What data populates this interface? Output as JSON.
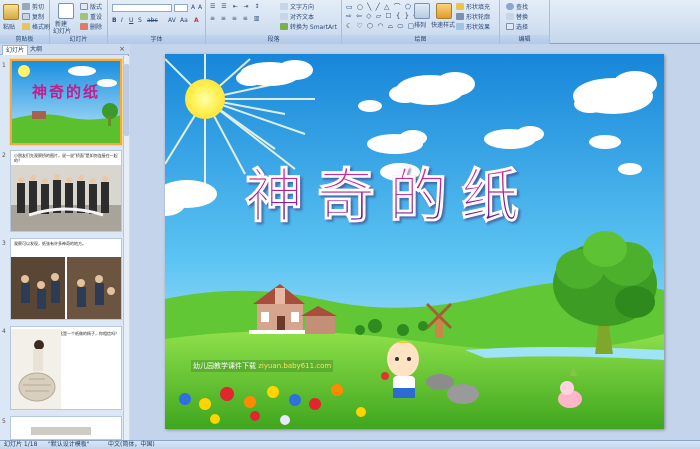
{
  "ribbon": {
    "clipboard": {
      "label": "剪贴板",
      "paste": "粘贴",
      "cut": "剪切",
      "copy": "复制",
      "format_painter": "格式刷"
    },
    "slides": {
      "label": "幻灯片",
      "new_slide": "新建",
      "new_slide_2": "幻灯片",
      "layout": "版式",
      "reset": "重设",
      "delete": "删除"
    },
    "font": {
      "label": "字体"
    },
    "paragraph": {
      "label": "段落",
      "text_direction": "文字方向",
      "align_text": "对齐文本",
      "smartart": "转换为 SmartArt"
    },
    "drawing": {
      "label": "绘图",
      "arrange": "排列",
      "quick_styles": "快速样式",
      "shape_fill": "形状填充",
      "shape_outline": "形状轮廓",
      "shape_effects": "形状效果"
    },
    "editing": {
      "label": "编辑",
      "find": "查找",
      "replace": "替换",
      "select": "选择"
    }
  },
  "panel": {
    "tab_slides": "幻灯片",
    "tab_outline": "大纲",
    "close": "×",
    "thumbnails": [
      {
        "num": "1",
        "title": "神奇的纸"
      },
      {
        "num": "2",
        "caption": "小朋友们先观察桥的图片，说一说\"桥面\"是如何连接在一起的？"
      },
      {
        "num": "3",
        "caption": "观察可以发现，纸张有许多神奇的地方。"
      },
      {
        "num": "4",
        "caption": "这是一个纸做的椅子，你相信吗？"
      },
      {
        "num": "5",
        "caption": ""
      }
    ]
  },
  "slide": {
    "title": "神奇的纸",
    "banner_prefix": "幼儿园教学课件下载",
    "banner_url": "ziyuan.baby611.com"
  },
  "status": {
    "slide_count": "幻灯片 1/18",
    "theme": "\"默认设计模板\"",
    "language": "中文(简体，中国)"
  },
  "colors": {
    "sky_top": "#1a8fe0",
    "grass": "#5cc02e",
    "title_pink": "#e0278f",
    "title_purple": "#3a1a9c",
    "selection": "#f3a93c"
  }
}
